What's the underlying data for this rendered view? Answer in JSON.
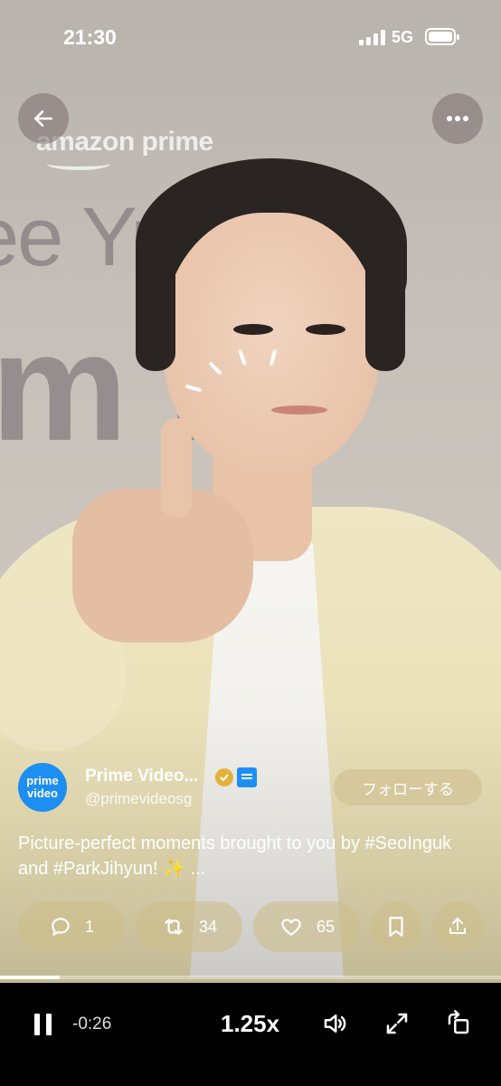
{
  "status_bar": {
    "time": "21:30",
    "network": "5G"
  },
  "video": {
    "brand_watermark": "amazon prime",
    "backdrop_line1": "ee Yu     Wo",
    "backdrop_line2": "m  ro"
  },
  "author": {
    "avatar_line1": "prime",
    "avatar_line2": "video",
    "name": "Prime Video...",
    "handle": "@primevideosg",
    "follow_label": "フォローする"
  },
  "caption": "Picture-perfect moments brought to you by #SeoInguk and #ParkJihyun! ✨ ...",
  "actions": {
    "replies": "1",
    "reposts": "34",
    "likes": "65"
  },
  "player": {
    "remaining": "-0:26",
    "speed": "1.25x",
    "progress": 0.12
  }
}
